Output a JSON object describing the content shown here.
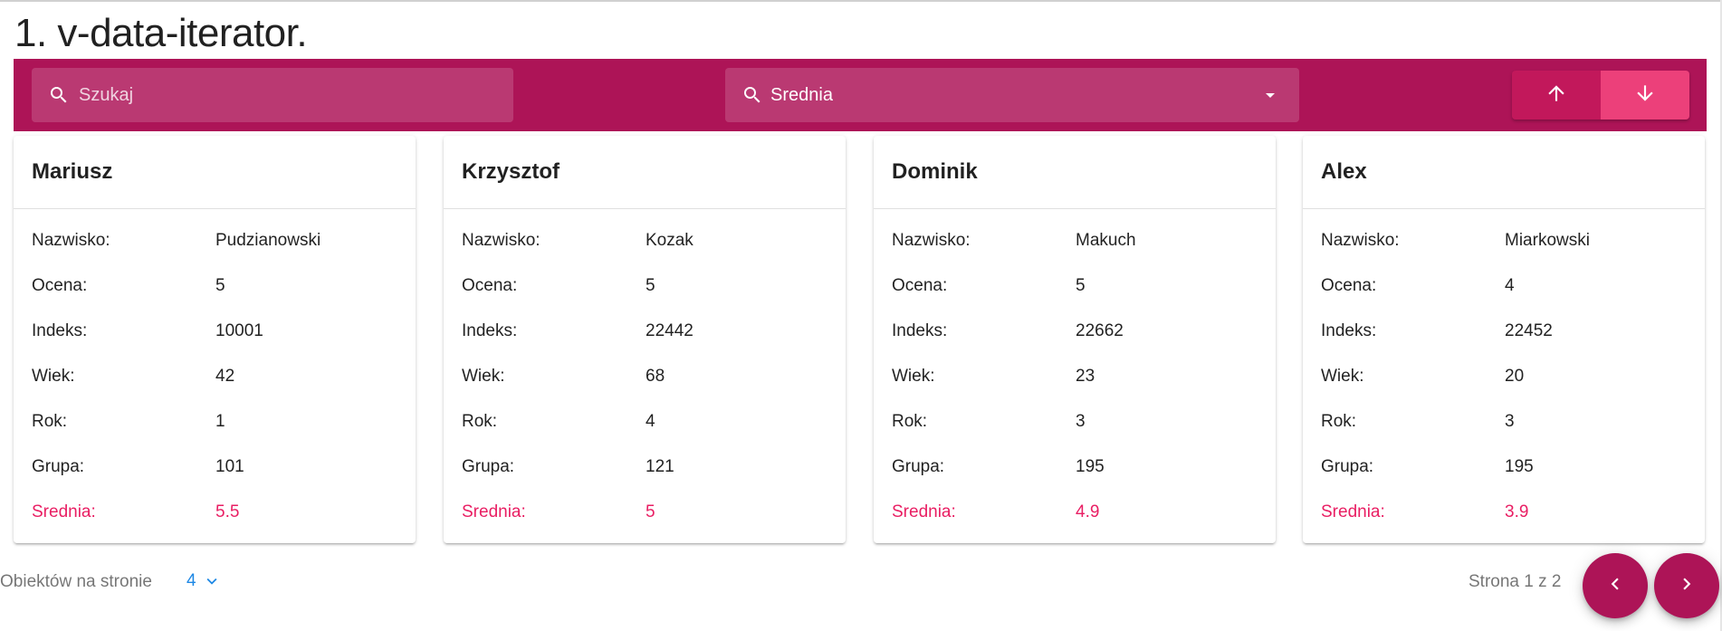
{
  "page": {
    "title": "1. v-data-iterator."
  },
  "toolbar": {
    "search_placeholder": "Szukaj",
    "search_value": "",
    "sort_by_value": "Srednia",
    "sort_asc_icon": "arrow-up-icon",
    "sort_desc_icon": "arrow-down-icon",
    "colors": {
      "toolbar_bg": "#ad1457",
      "asc_bg": "#c2185b",
      "desc_bg": "#ec407a"
    }
  },
  "field_labels": {
    "nazwisko": "Nazwisko:",
    "ocena": "Ocena:",
    "indeks": "Indeks:",
    "wiek": "Wiek:",
    "rok": "Rok:",
    "grupa": "Grupa:",
    "srednia": "Srednia:"
  },
  "cards": [
    {
      "name": "Mariusz",
      "nazwisko": "Pudzianowski",
      "ocena": "5",
      "indeks": "10001",
      "wiek": "42",
      "rok": "1",
      "grupa": "101",
      "srednia": "5.5"
    },
    {
      "name": "Krzysztof",
      "nazwisko": "Kozak",
      "ocena": "5",
      "indeks": "22442",
      "wiek": "68",
      "rok": "4",
      "grupa": "121",
      "srednia": "5"
    },
    {
      "name": "Dominik",
      "nazwisko": "Makuch",
      "ocena": "5",
      "indeks": "22662",
      "wiek": "23",
      "rok": "3",
      "grupa": "195",
      "srednia": "4.9"
    },
    {
      "name": "Alex",
      "nazwisko": "Miarkowski",
      "ocena": "4",
      "indeks": "22452",
      "wiek": "20",
      "rok": "3",
      "grupa": "195",
      "srednia": "3.9"
    }
  ],
  "footer": {
    "items_per_page_label": "Obiektów na stronie",
    "items_per_page_value": "4",
    "page_indicator": "Strona 1 z 2",
    "accent_color": "#e91e63",
    "link_color": "#1e88e5"
  }
}
